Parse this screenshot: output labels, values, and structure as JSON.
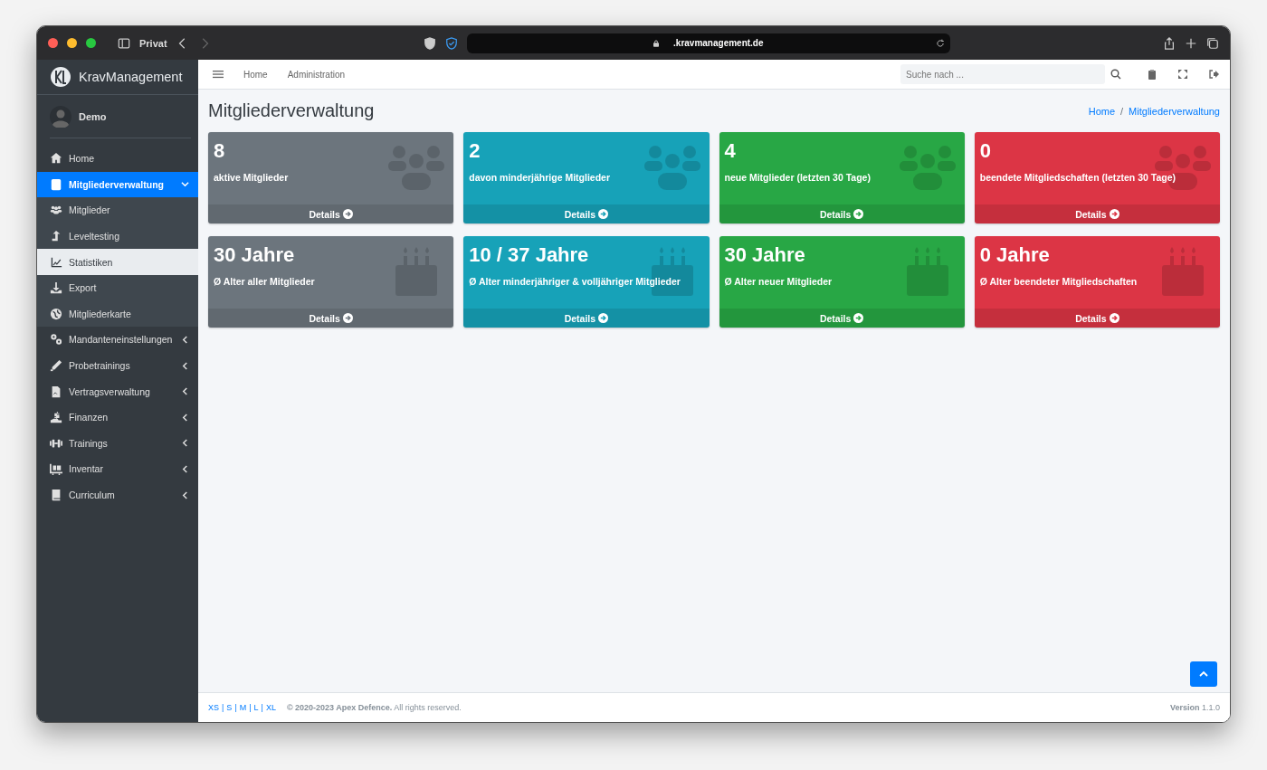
{
  "browser": {
    "profile": "Privat",
    "url": ".kravmanagement.de"
  },
  "brand": {
    "name": "KravManagement"
  },
  "user": {
    "name": "Demo"
  },
  "sidebar": {
    "items": [
      {
        "label": "Home",
        "selected": false
      },
      {
        "label": "Mitgliederverwaltung",
        "selected": true,
        "expanded": true,
        "children": [
          {
            "label": "Mitglieder",
            "selected": false
          },
          {
            "label": "Leveltesting",
            "selected": false
          },
          {
            "label": "Statistiken",
            "selected": true
          },
          {
            "label": "Export",
            "selected": false
          },
          {
            "label": "Mitgliederkarte",
            "selected": false
          }
        ]
      },
      {
        "label": "Mandanteneinstellungen",
        "selected": false,
        "expanded": false
      },
      {
        "label": "Probetrainings",
        "selected": false,
        "expanded": false
      },
      {
        "label": "Vertragsverwaltung",
        "selected": false,
        "expanded": false
      },
      {
        "label": "Finanzen",
        "selected": false,
        "expanded": false
      },
      {
        "label": "Trainings",
        "selected": false,
        "expanded": false
      },
      {
        "label": "Inventar",
        "selected": false,
        "expanded": false
      },
      {
        "label": "Curriculum",
        "selected": false,
        "expanded": false
      }
    ]
  },
  "navbar": {
    "links": [
      "Home",
      "Administration"
    ],
    "search": {
      "placeholder": "Suche nach ..."
    }
  },
  "page": {
    "title": "Mitgliederverwaltung",
    "breadcrumb": [
      "Home",
      "Mitgliederverwaltung"
    ],
    "breadcrumb_separator": "/"
  },
  "cards": [
    {
      "value": "8",
      "label": "aktive Mitglieder",
      "link": "Details",
      "color": "#6c757d",
      "kind": "users"
    },
    {
      "value": "2",
      "label": "davon minderjährige Mitglieder",
      "link": "Details",
      "color": "#17a2b8",
      "kind": "users"
    },
    {
      "value": "4",
      "label": "neue Mitglieder (letzten 30 Tage)",
      "link": "Details",
      "color": "#28a745",
      "kind": "users"
    },
    {
      "value": "0",
      "label": "beendete Mitgliedschaften (letzten 30 Tage)",
      "link": "Details",
      "color": "#dc3545",
      "kind": "users"
    },
    {
      "value": "30 Jahre",
      "label": "Ø Alter aller Mitglieder",
      "link": "Details",
      "color": "#6c757d",
      "kind": "cake"
    },
    {
      "value": "10 / 37 Jahre",
      "label": "Ø Alter minderjähriger & volljähriger Mitglieder",
      "link": "Details",
      "color": "#17a2b8",
      "kind": "cake"
    },
    {
      "value": "30 Jahre",
      "label": "Ø Alter neuer Mitglieder",
      "link": "Details",
      "color": "#28a745",
      "kind": "cake"
    },
    {
      "value": "0 Jahre",
      "label": "Ø Alter beendeter Mitgliedschaften",
      "link": "Details",
      "color": "#dc3545",
      "kind": "cake"
    }
  ],
  "footer": {
    "sizes": [
      "XS",
      "S",
      "M",
      "L",
      "XL"
    ],
    "separators": [
      "|",
      "|",
      "|",
      "|"
    ],
    "copyright": "**© 2020-2023 Apex Defence.** All rights reserved.",
    "version": "**Version** 1.1.0"
  }
}
